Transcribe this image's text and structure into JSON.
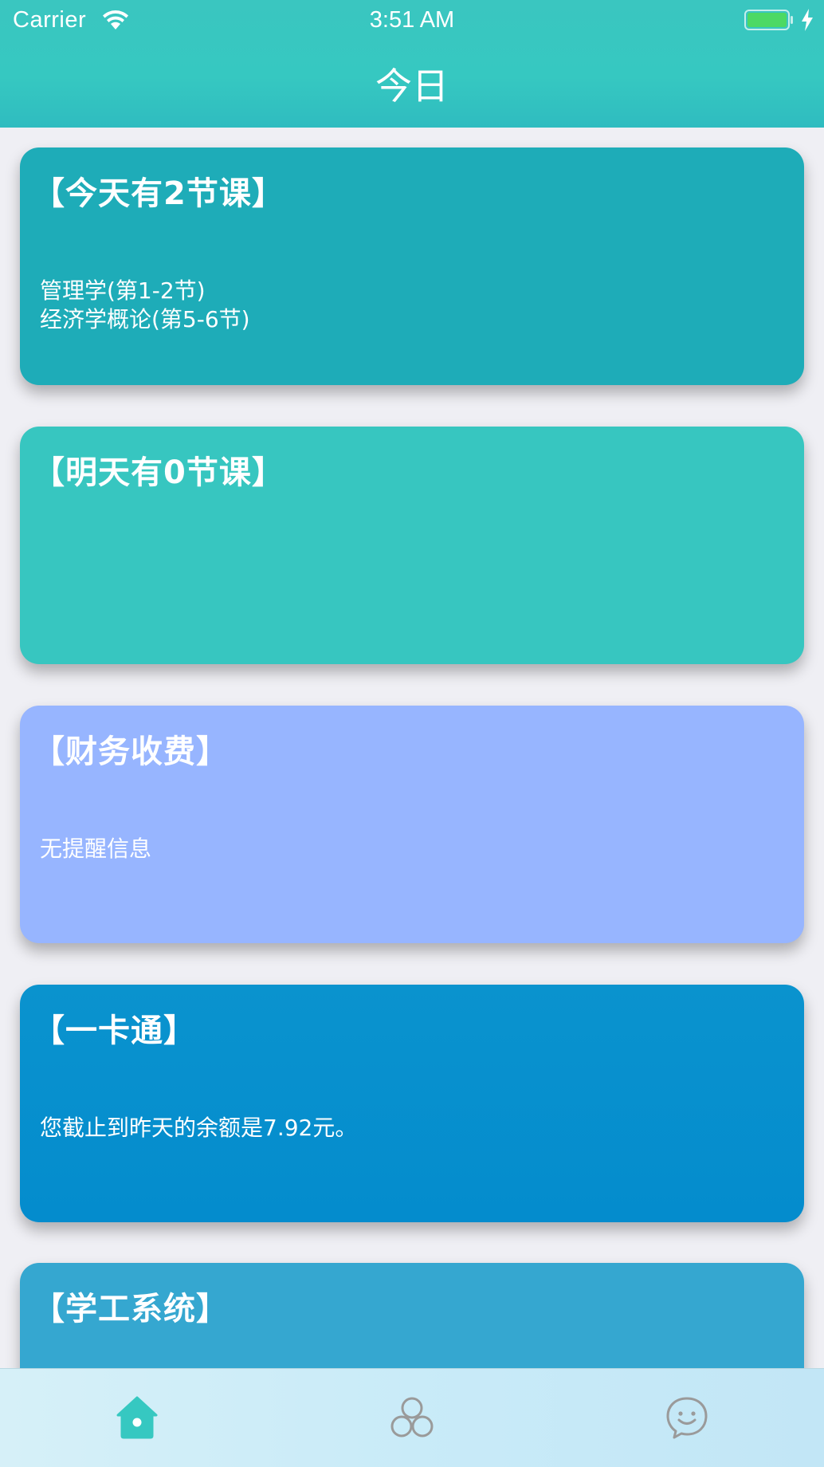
{
  "status_bar": {
    "carrier": "Carrier",
    "time": "3:51 AM",
    "icons": [
      "wifi-icon",
      "battery-icon",
      "charging-bolt-icon"
    ]
  },
  "nav": {
    "title": "今日"
  },
  "cards": [
    {
      "title": "【今天有2节课】",
      "lines": [
        "管理学(第1-2节)",
        "经济学概论(第5-6节)"
      ],
      "color": "#1eacb8"
    },
    {
      "title": "【明天有0节课】",
      "lines": [],
      "color": "#37c6c0"
    },
    {
      "title": "【财务收费】",
      "lines": [
        "无提醒信息"
      ],
      "color": "#97b5ff"
    },
    {
      "title": "【一卡通】",
      "lines": [
        "您截止到昨天的余额是7.92元。"
      ],
      "color": "#048ccd"
    },
    {
      "title": "【学工系统】",
      "lines": [],
      "color": "#35a7d0"
    }
  ],
  "tabbar": {
    "items": [
      {
        "icon": "home-icon",
        "active": true
      },
      {
        "icon": "circles-icon",
        "active": false
      },
      {
        "icon": "chat-face-icon",
        "active": false
      }
    ],
    "active_color": "#36c8c1",
    "inactive_color": "#9a9a9a"
  }
}
